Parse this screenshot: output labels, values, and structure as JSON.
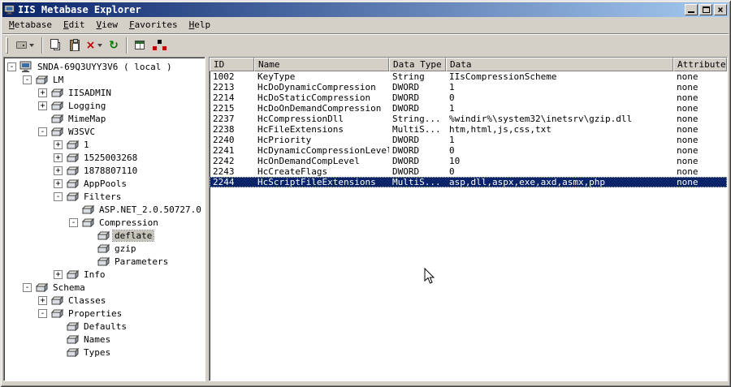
{
  "window": {
    "title": "IIS Metabase Explorer"
  },
  "menu": {
    "items": [
      "Metabase",
      "Edit",
      "View",
      "Favorites",
      "Help"
    ]
  },
  "toolbar": {
    "buttons": [
      {
        "icon": "drive-up-icon",
        "split": true
      },
      {
        "icon": "copy-icon"
      },
      {
        "icon": "paste-icon"
      },
      {
        "icon": "delete-icon"
      },
      {
        "icon": "refresh-icon"
      },
      {
        "icon": "export-grid-icon"
      },
      {
        "icon": "network-icon"
      }
    ]
  },
  "colors": {
    "titlebar_start": "#0a246a",
    "titlebar_end": "#a6caf0",
    "selection": "#0a246a",
    "window_bg": "#d4d0c8",
    "inactive_selection": "#c6c3bb"
  },
  "tree": {
    "items": [
      {
        "label": "SNDA-69Q3UYY3V6 ( local )",
        "level": 0,
        "expand": "minus",
        "icon": "computer-icon",
        "selected": false
      },
      {
        "label": "LM",
        "level": 1,
        "expand": "minus",
        "icon": "key-icon",
        "selected": false
      },
      {
        "label": "IISADMIN",
        "level": 2,
        "expand": "plus",
        "icon": "key-icon",
        "selected": false
      },
      {
        "label": "Logging",
        "level": 2,
        "expand": "plus",
        "icon": "key-icon",
        "selected": false
      },
      {
        "label": "MimeMap",
        "level": 2,
        "expand": "none",
        "icon": "key-icon",
        "selected": false
      },
      {
        "label": "W3SVC",
        "level": 2,
        "expand": "minus",
        "icon": "key-icon",
        "selected": false
      },
      {
        "label": "1",
        "level": 3,
        "expand": "plus",
        "icon": "key-icon",
        "selected": false
      },
      {
        "label": "1525003268",
        "level": 3,
        "expand": "plus",
        "icon": "key-icon",
        "selected": false
      },
      {
        "label": "1878807110",
        "level": 3,
        "expand": "plus",
        "icon": "key-icon",
        "selected": false
      },
      {
        "label": "AppPools",
        "level": 3,
        "expand": "plus",
        "icon": "key-icon",
        "selected": false
      },
      {
        "label": "Filters",
        "level": 3,
        "expand": "minus",
        "icon": "key-icon",
        "selected": false
      },
      {
        "label": "ASP.NET_2.0.50727.0",
        "level": 4,
        "expand": "none",
        "icon": "key-icon",
        "selected": false
      },
      {
        "label": "Compression",
        "level": 4,
        "expand": "minus",
        "icon": "key-icon",
        "selected": false
      },
      {
        "label": "deflate",
        "level": 5,
        "expand": "none",
        "icon": "key-icon",
        "selected": true
      },
      {
        "label": "gzip",
        "level": 5,
        "expand": "none",
        "icon": "key-icon",
        "selected": false
      },
      {
        "label": "Parameters",
        "level": 5,
        "expand": "none",
        "icon": "key-icon",
        "selected": false
      },
      {
        "label": "Info",
        "level": 3,
        "expand": "plus",
        "icon": "key-icon",
        "selected": false
      },
      {
        "label": "Schema",
        "level": 1,
        "expand": "minus",
        "icon": "key-icon",
        "selected": false
      },
      {
        "label": "Classes",
        "level": 2,
        "expand": "plus",
        "icon": "key-icon",
        "selected": false
      },
      {
        "label": "Properties",
        "level": 2,
        "expand": "minus",
        "icon": "key-icon",
        "selected": false
      },
      {
        "label": "Defaults",
        "level": 3,
        "expand": "none",
        "icon": "key-icon",
        "selected": false
      },
      {
        "label": "Names",
        "level": 3,
        "expand": "none",
        "icon": "key-icon",
        "selected": false
      },
      {
        "label": "Types",
        "level": 3,
        "expand": "none",
        "icon": "key-icon",
        "selected": false
      }
    ]
  },
  "list": {
    "columns": [
      "ID",
      "Name",
      "Data Type",
      "Data",
      "Attributes"
    ],
    "rows": [
      {
        "id": "1002",
        "name": "KeyType",
        "type": "String",
        "data": "IIsCompressionScheme",
        "attrs": "none",
        "selected": false
      },
      {
        "id": "2213",
        "name": "HcDoDynamicCompression",
        "type": "DWORD",
        "data": "1",
        "attrs": "none",
        "selected": false
      },
      {
        "id": "2214",
        "name": "HcDoStaticCompression",
        "type": "DWORD",
        "data": "0",
        "attrs": "none",
        "selected": false
      },
      {
        "id": "2215",
        "name": "HcDoOnDemandCompression",
        "type": "DWORD",
        "data": "1",
        "attrs": "none",
        "selected": false
      },
      {
        "id": "2237",
        "name": "HcCompressionDll",
        "type": "String...",
        "data": "%windir%\\system32\\inetsrv\\gzip.dll",
        "attrs": "none",
        "selected": false
      },
      {
        "id": "2238",
        "name": "HcFileExtensions",
        "type": "MultiS...",
        "data": "htm,html,js,css,txt",
        "attrs": "none",
        "selected": false
      },
      {
        "id": "2240",
        "name": "HcPriority",
        "type": "DWORD",
        "data": "1",
        "attrs": "none",
        "selected": false
      },
      {
        "id": "2241",
        "name": "HcDynamicCompressionLevel",
        "type": "DWORD",
        "data": "0",
        "attrs": "none",
        "selected": false
      },
      {
        "id": "2242",
        "name": "HcOnDemandCompLevel",
        "type": "DWORD",
        "data": "10",
        "attrs": "none",
        "selected": false
      },
      {
        "id": "2243",
        "name": "HcCreateFlags",
        "type": "DWORD",
        "data": "0",
        "attrs": "none",
        "selected": false
      },
      {
        "id": "2244",
        "name": "HcScriptFileExtensions",
        "type": "MultiS...",
        "data": "asp,dll,aspx,exe,axd,asmx,php",
        "attrs": "none",
        "selected": true
      }
    ]
  }
}
